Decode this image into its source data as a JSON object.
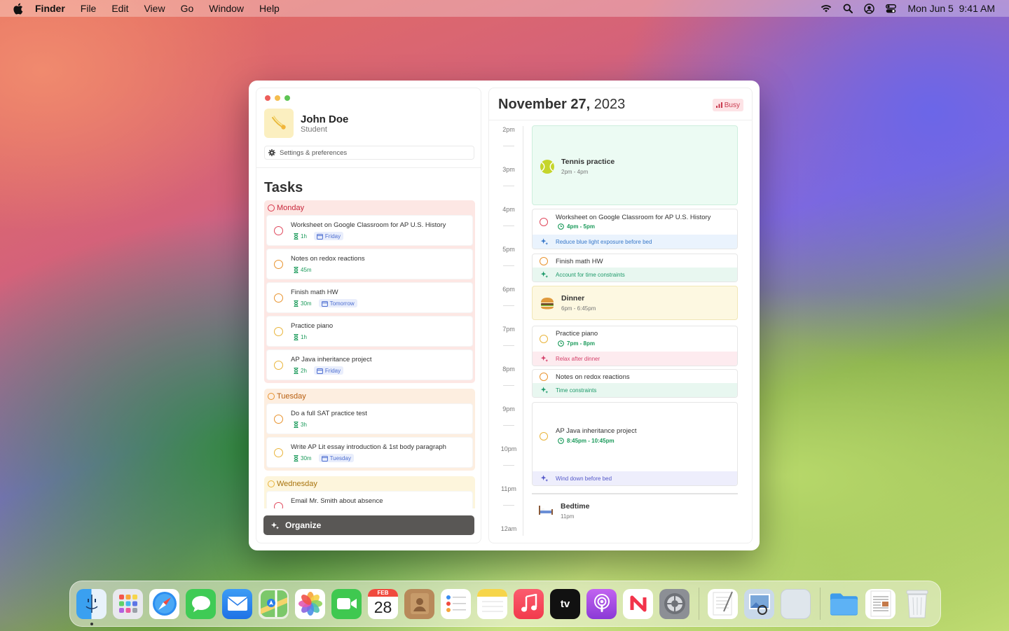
{
  "menubar": {
    "app_name": "Finder",
    "menus": [
      "File",
      "Edit",
      "View",
      "Go",
      "Window",
      "Help"
    ],
    "clock": "Mon Jun 5  9:41 AM",
    "status_icons": [
      "wifi-icon",
      "search-icon",
      "user-icon",
      "control-center-icon"
    ]
  },
  "user": {
    "name": "John Doe",
    "role": "Student",
    "settings_label": "Settings & preferences"
  },
  "tasks": {
    "title": "Tasks",
    "organize_label": "Organize",
    "groups": [
      {
        "day": "Monday",
        "items": [
          {
            "title": "Worksheet on Google Classroom for AP U.S. History",
            "duration": "1h",
            "due": "Friday"
          },
          {
            "title": "Notes on redox reactions",
            "duration": "45m",
            "due": ""
          },
          {
            "title": "Finish math HW",
            "duration": "30m",
            "due": "Tomorrow"
          },
          {
            "title": "Practice piano",
            "duration": "1h",
            "due": ""
          },
          {
            "title": "AP Java inheritance project",
            "duration": "2h",
            "due": "Friday"
          }
        ]
      },
      {
        "day": "Tuesday",
        "items": [
          {
            "title": "Do a full SAT practice test",
            "duration": "3h",
            "due": ""
          },
          {
            "title": "Write AP Lit essay introduction & 1st body paragraph",
            "duration": "30m",
            "due": "Tuesday"
          }
        ]
      },
      {
        "day": "Wednesday",
        "items": [
          {
            "title": "Email Mr. Smith about absence",
            "duration": "",
            "due": ""
          }
        ]
      }
    ]
  },
  "calendar": {
    "date_bold": "November 27,",
    "date_year": " 2023",
    "status": "Busy",
    "hours": [
      "2pm",
      "3pm",
      "4pm",
      "5pm",
      "6pm",
      "7pm",
      "8pm",
      "9pm",
      "10pm",
      "11pm",
      "12am"
    ],
    "events": {
      "tennis": {
        "title": "Tennis practice",
        "time": "2pm - 4pm"
      },
      "worksheet": {
        "title": "Worksheet on Google Classroom for AP U.S. History",
        "time": "4pm - 5pm",
        "note": "Reduce blue light exposure before bed"
      },
      "math": {
        "title": "Finish math HW",
        "note": "Account for time constraints"
      },
      "dinner": {
        "title": "Dinner",
        "time": "6pm - 6:45pm"
      },
      "piano": {
        "title": "Practice piano",
        "time": "7pm - 8pm",
        "note": "Relax after dinner"
      },
      "redox": {
        "title": "Notes on redox reactions",
        "note": "Time constraints"
      },
      "java": {
        "title": "AP Java inheritance project",
        "time": "8:45pm - 10:45pm",
        "note": "Wind down before bed"
      },
      "bedtime": {
        "title": "Bedtime",
        "time": "11pm"
      }
    }
  },
  "dock": {
    "calendar_month": "FEB",
    "calendar_day": "28",
    "tv_label": "tv"
  }
}
